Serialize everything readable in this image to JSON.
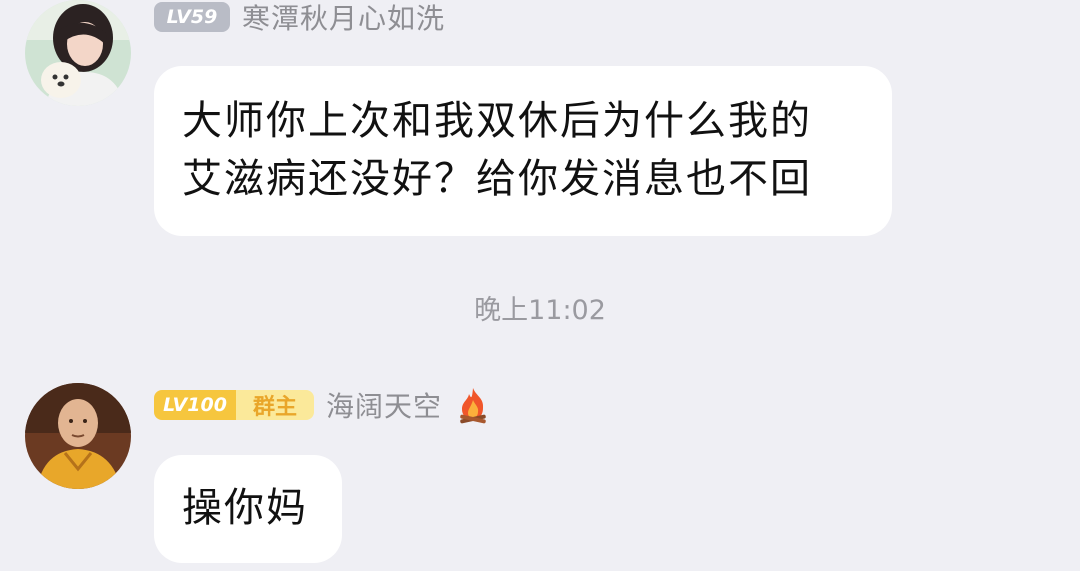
{
  "messages": [
    {
      "level": "LV59",
      "owner_badge": "",
      "sender": "寒潭秋月心如洗",
      "text_line1": "大师你上次和我双休后为什么我的",
      "text_line2": "艾滋病还没好？给你发消息也不回"
    },
    {
      "level": "LV100",
      "owner_badge": "群主",
      "sender": "海阔天空",
      "text_line1": "操你妈",
      "status_icon": "flame-icon"
    }
  ],
  "timestamp": "晚上11:02",
  "colors": {
    "background": "#efeff4",
    "bubble": "#ffffff",
    "level_grey": "#b9bcc6",
    "level_gold": "#f6c63e",
    "owner_badge_bg": "#fbe99a",
    "owner_badge_text": "#e9a62a",
    "sender_name": "#8e8e93",
    "timestamp": "#9a9aa0"
  }
}
